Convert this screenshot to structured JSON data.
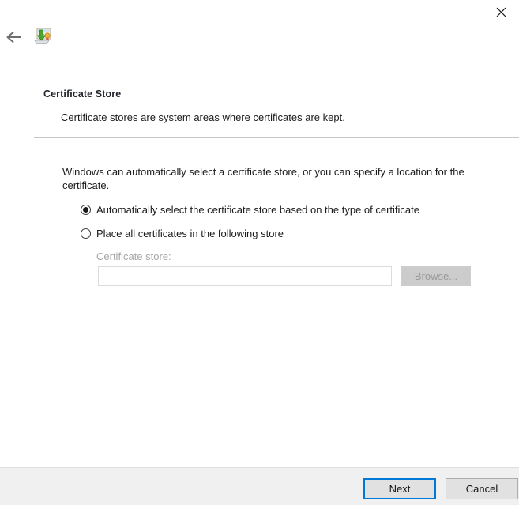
{
  "window": {
    "close_label": "✕",
    "back_label": "←",
    "icon_name": "certificate-import-icon"
  },
  "header": {
    "title": "Certificate Store",
    "subtitle": "Certificate stores are system areas where certificates are kept."
  },
  "main": {
    "description": "Windows can automatically select a certificate store, or you can specify a location for the certificate.",
    "options": [
      {
        "label": "Automatically select the certificate store based on the type of certificate",
        "selected": true
      },
      {
        "label": "Place all certificates in the following store",
        "selected": false
      }
    ],
    "store_field": {
      "label": "Certificate store:",
      "value": "",
      "placeholder": "",
      "browse_label": "Browse...",
      "disabled": true
    }
  },
  "footer": {
    "next_label": "Next",
    "cancel_label": "Cancel"
  },
  "colors": {
    "accent": "#0078d7",
    "footer_bg": "#f0f0f0",
    "text": "#1b1b1b",
    "disabled_text": "#a6a6a6"
  }
}
